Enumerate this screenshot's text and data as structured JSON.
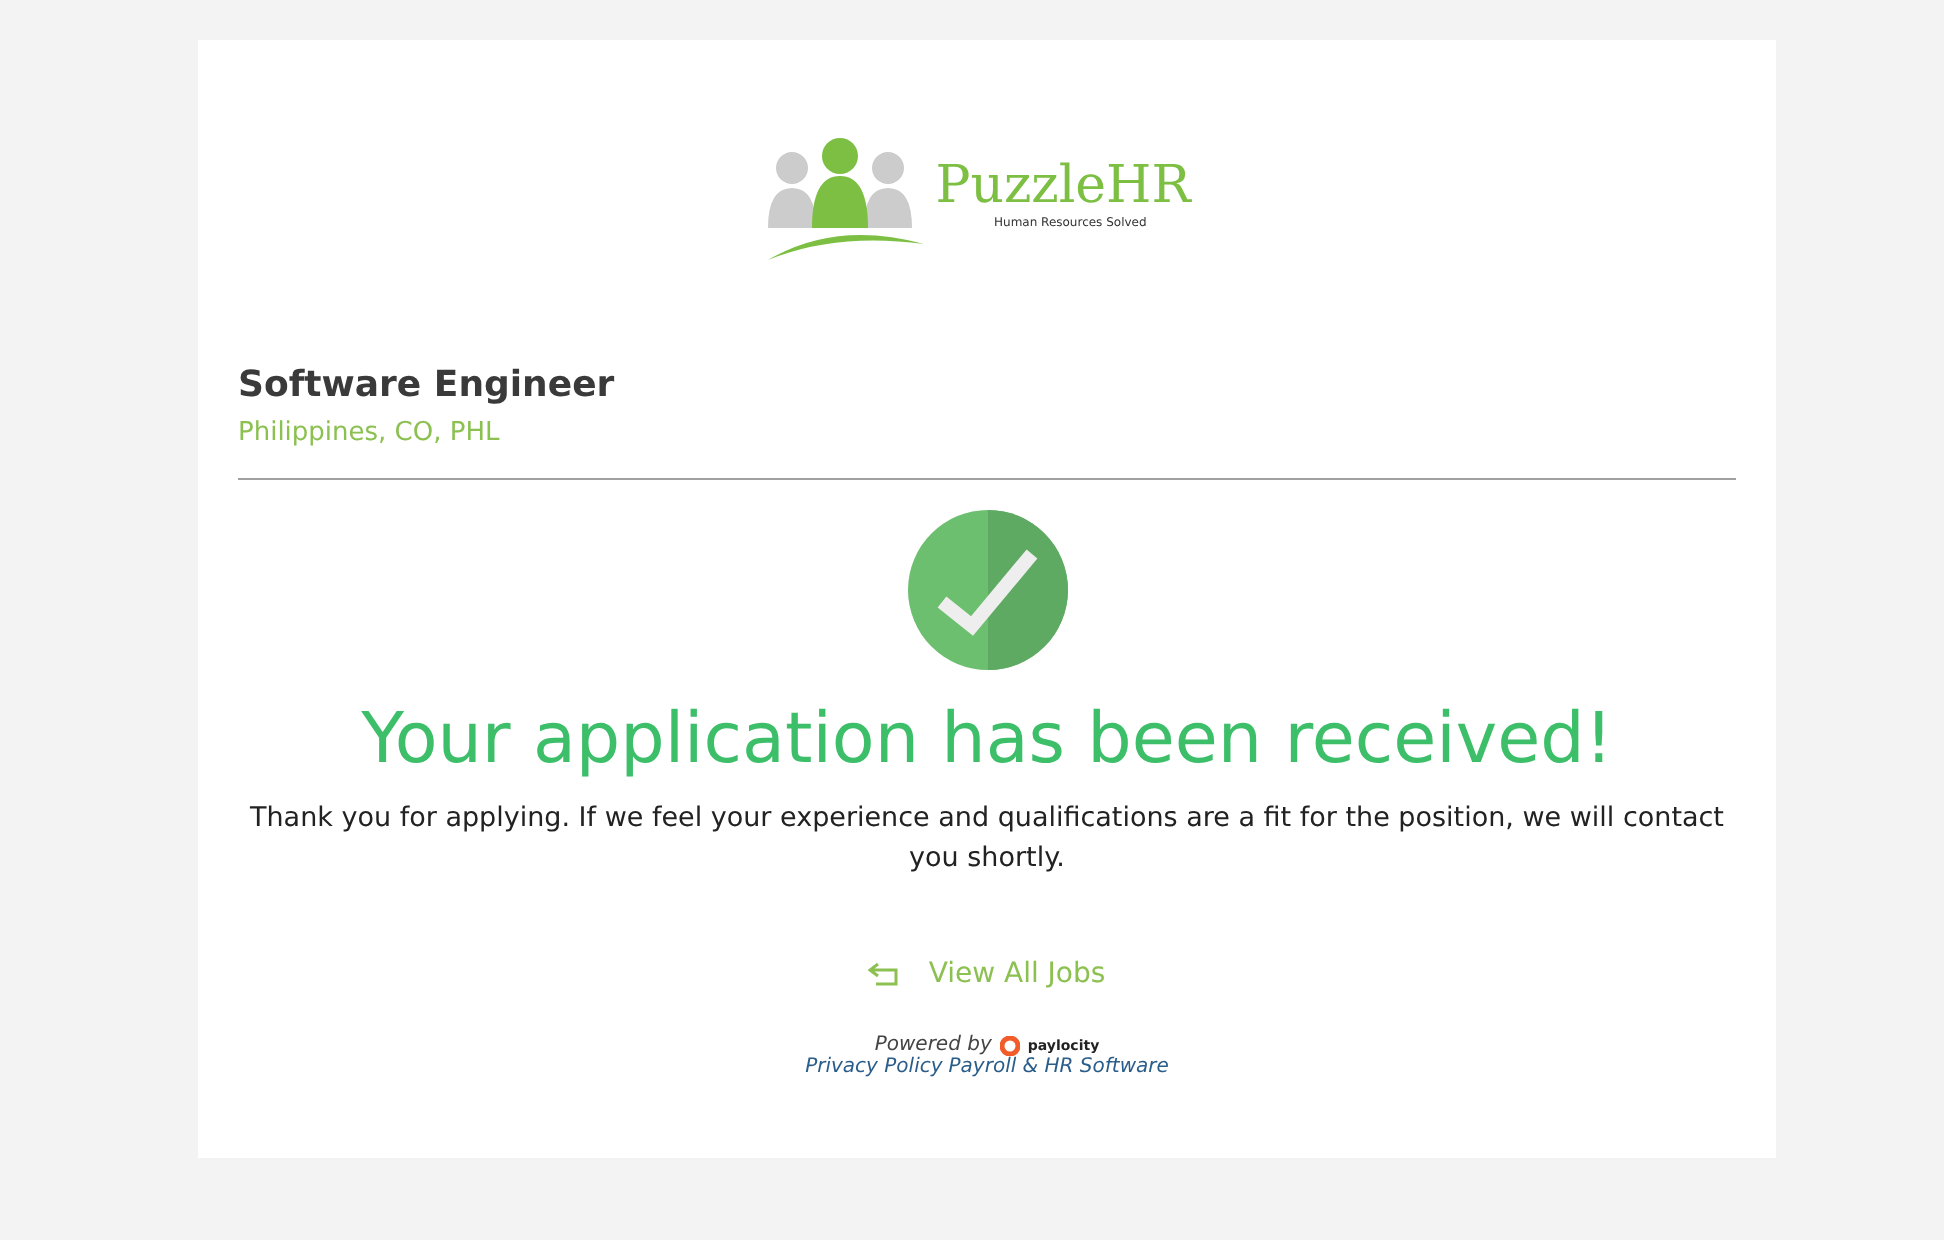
{
  "logo": {
    "name": "PuzzleHR",
    "tagline": "Human Resources Solved"
  },
  "job": {
    "title": "Software Engineer",
    "location": "Philippines, CO, PHL"
  },
  "confirmation": {
    "heading": "Your application has been received!",
    "message": "Thank you for applying. If we feel your experience and qualifications are a fit for the position, we will contact you shortly."
  },
  "back_link": {
    "label": "View All Jobs"
  },
  "footer": {
    "powered_by": "Powered by",
    "brand": "paylocity",
    "links": [
      "Privacy Policy",
      "Payroll & HR Software"
    ]
  }
}
